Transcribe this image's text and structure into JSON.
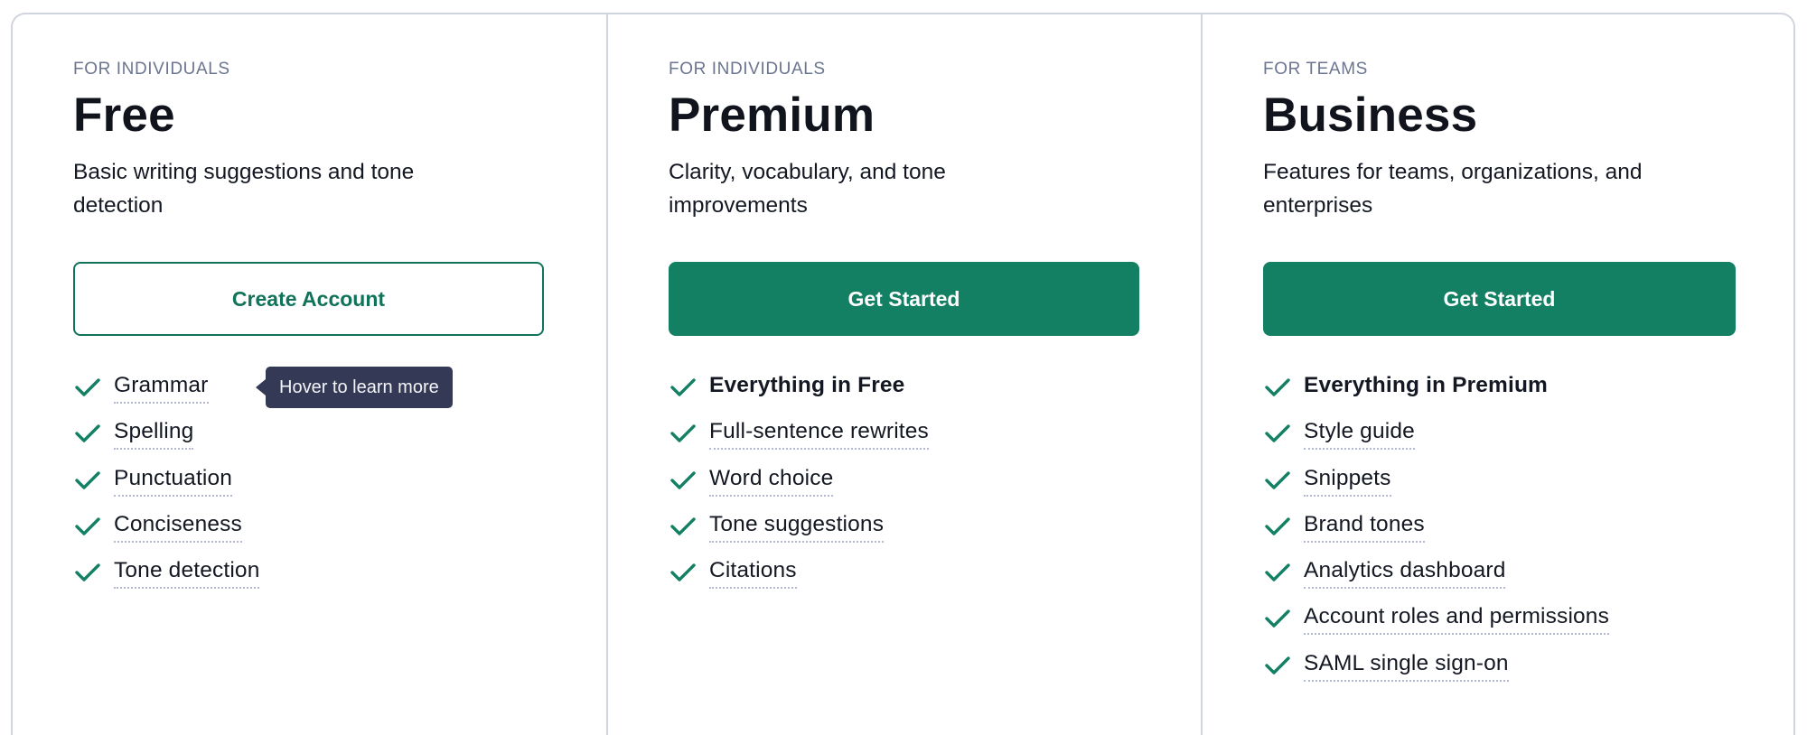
{
  "colors": {
    "brand_green": "#137f63",
    "outline_green": "#11735a",
    "tooltip_bg": "#343a56",
    "label_gray": "#6b7590",
    "border": "#d1d5e0"
  },
  "plans": [
    {
      "audience": "FOR INDIVIDUALS",
      "name": "Free",
      "description": "Basic writing suggestions and tone detection",
      "cta_label": "Create Account",
      "cta_style": "outline",
      "features": [
        {
          "label": "Grammar",
          "bold": false,
          "icon": "check-icon"
        },
        {
          "label": "Spelling",
          "bold": false,
          "icon": "check-icon"
        },
        {
          "label": "Punctuation",
          "bold": false,
          "icon": "check-icon"
        },
        {
          "label": "Conciseness",
          "bold": false,
          "icon": "check-icon"
        },
        {
          "label": "Tone detection",
          "bold": false,
          "icon": "check-icon"
        }
      ]
    },
    {
      "audience": "FOR INDIVIDUALS",
      "name": "Premium",
      "description": "Clarity, vocabulary, and tone improvements",
      "cta_label": "Get Started",
      "cta_style": "solid",
      "features": [
        {
          "label": "Everything in Free",
          "bold": true,
          "icon": "check-icon"
        },
        {
          "label": "Full-sentence rewrites",
          "bold": false,
          "icon": "check-icon"
        },
        {
          "label": "Word choice",
          "bold": false,
          "icon": "check-icon"
        },
        {
          "label": "Tone suggestions",
          "bold": false,
          "icon": "check-icon"
        },
        {
          "label": "Citations",
          "bold": false,
          "icon": "check-icon"
        }
      ]
    },
    {
      "audience": "FOR TEAMS",
      "name": "Business",
      "description": "Features for teams, organizations, and enterprises",
      "cta_label": "Get Started",
      "cta_style": "solid",
      "features": [
        {
          "label": "Everything in Premium",
          "bold": true,
          "icon": "check-icon"
        },
        {
          "label": "Style guide",
          "bold": false,
          "icon": "check-icon"
        },
        {
          "label": "Snippets",
          "bold": false,
          "icon": "check-icon"
        },
        {
          "label": "Brand tones",
          "bold": false,
          "icon": "check-icon"
        },
        {
          "label": "Analytics dashboard",
          "bold": false,
          "icon": "check-icon"
        },
        {
          "label": "Account roles and permissions",
          "bold": false,
          "icon": "check-icon"
        },
        {
          "label": "SAML single sign-on",
          "bold": false,
          "icon": "check-icon"
        }
      ]
    }
  ],
  "tooltip": {
    "text": "Hover to learn more",
    "attached_to": "Grammar"
  }
}
